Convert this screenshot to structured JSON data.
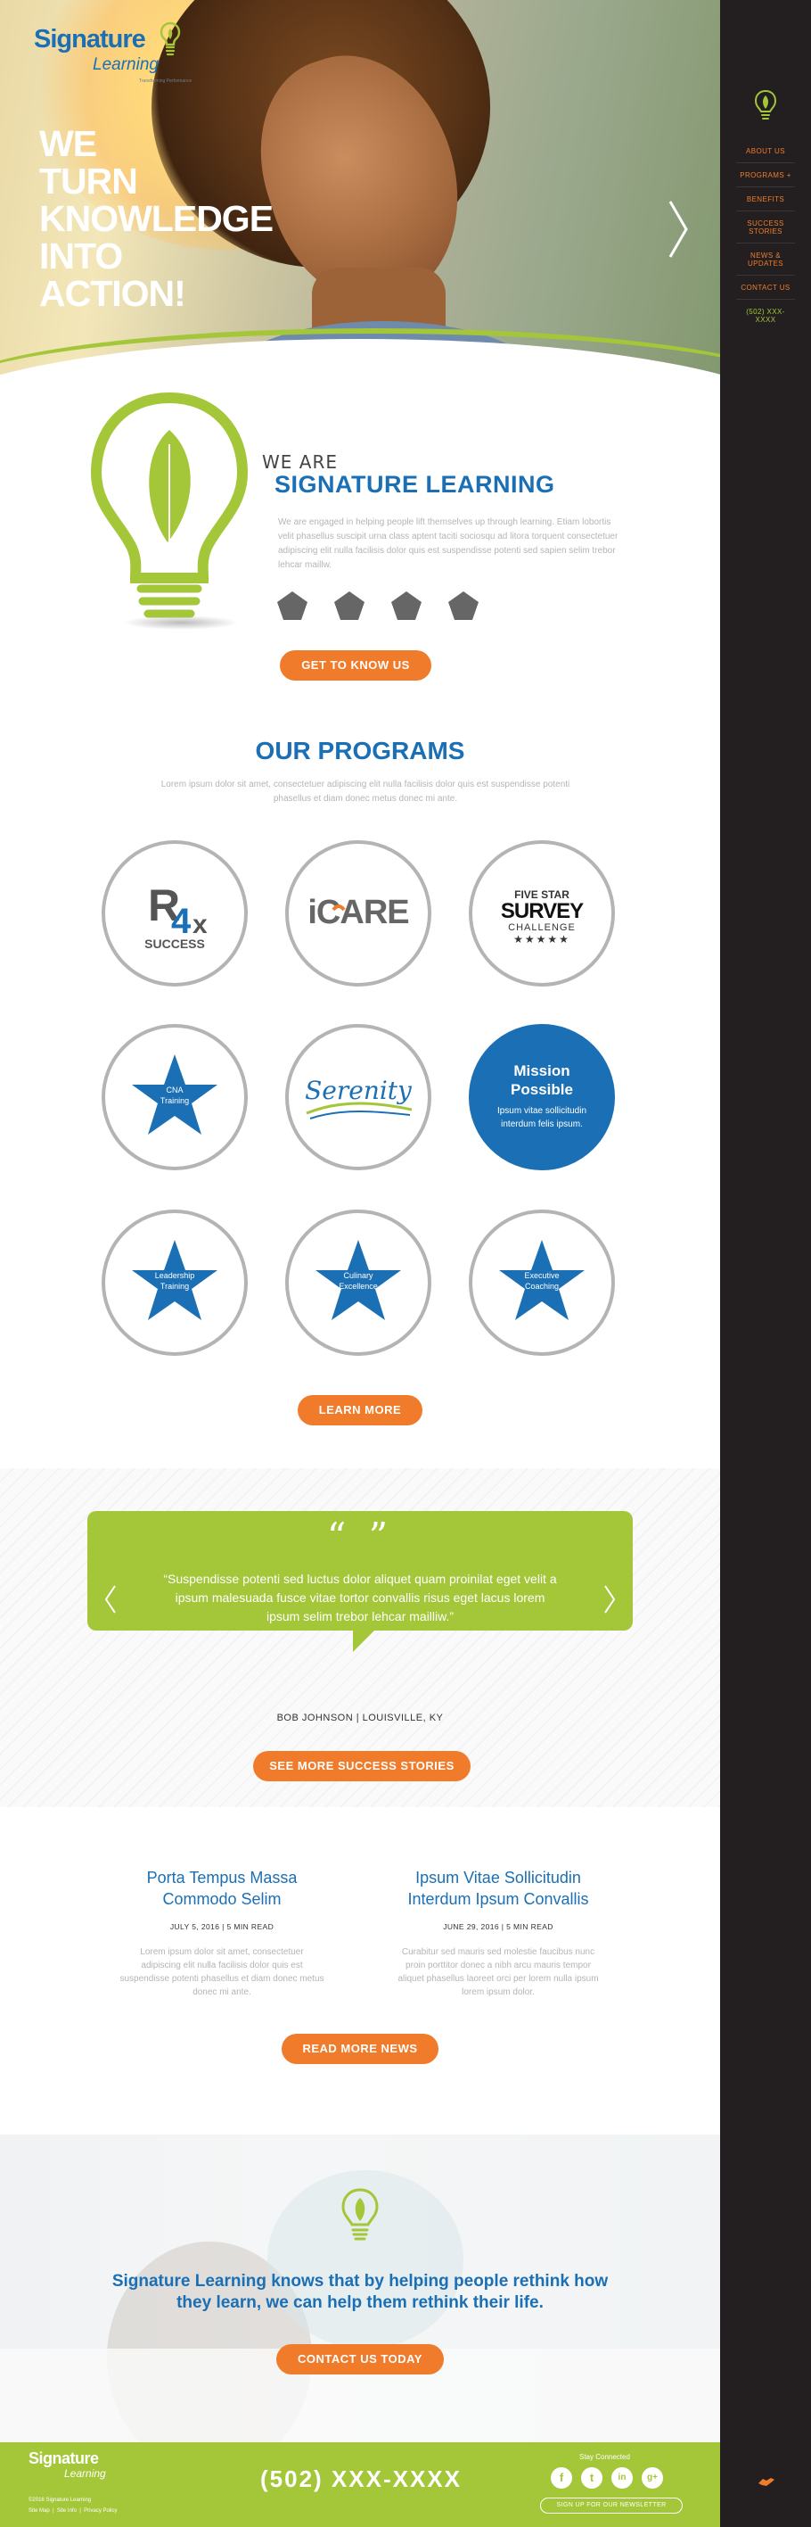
{
  "brand": {
    "logo_main": "Signature",
    "logo_sub": "Learning",
    "tagline": "Transforming Performance"
  },
  "nav": {
    "items": [
      {
        "label": "ABOUT US"
      },
      {
        "label": "PROGRAMS +"
      },
      {
        "label": "BENEFITS"
      },
      {
        "label": "SUCCESS STORIES"
      },
      {
        "label": "NEWS & UPDATES"
      },
      {
        "label": "CONTACT US"
      }
    ],
    "phone": "(502) XXX-XXXX"
  },
  "hero": {
    "line1": "WE",
    "line2": "TURN",
    "line3": "KNOWLEDGE",
    "line4": "INTO",
    "line5": "ACTION!",
    "next_icon": "chevron-right-icon"
  },
  "about": {
    "kicker": "WE ARE",
    "title": "SIGNATURE LEARNING",
    "text": "We are engaged in helping people lift themselves up through learning. Etiam lobortis velit phasellus suscipit urna class aptent taciti sociosqu ad litora torquent consectetuer adipiscing elit nulla facilisis dolor quis est suspendisse potenti sed sapien selim trebor lehcar maillw.",
    "button": "GET TO KNOW US"
  },
  "programs": {
    "title": "OUR PROGRAMS",
    "subtitle": "Lorem ipsum dolor sit amet, consectetuer adipiscing elit nulla facilisis dolor quis est suspendisse potenti phasellus et diam donec metus donec mi ante.",
    "items": [
      {
        "name": "Rx 4 Success",
        "line1": "R",
        "line2": "4x",
        "line3": "SUCCESS"
      },
      {
        "name": "iCARE",
        "label": "iCARE"
      },
      {
        "name": "Five Star Survey Challenge",
        "line1": "FIVE STAR",
        "line2": "SURVEY",
        "line3": "CHALLENGE",
        "stars": "★★★★★"
      },
      {
        "name": "CNA Training",
        "label1": "CNA",
        "label2": "Training"
      },
      {
        "name": "Serenity",
        "label": "Serenity"
      },
      {
        "name": "Mission Possible",
        "title1": "Mission",
        "title2": "Possible",
        "text": "Ipsum vitae sollicitudin interdum felis ipsum."
      },
      {
        "name": "Leadership Training",
        "label1": "Leadership",
        "label2": "Training"
      },
      {
        "name": "Culinary Excellence",
        "label1": "Culinary",
        "label2": "Excellence"
      },
      {
        "name": "Executive Coaching",
        "label1": "Executive",
        "label2": "Coaching"
      }
    ],
    "button": "LEARN MORE"
  },
  "testimonial": {
    "quote_marks": "“ ”",
    "text": "“Suspendisse potenti sed luctus dolor aliquet quam proinilat eget velit a ipsum malesuada fusce vitae tortor convallis risus eget lacus lorem ipsum selim trebor lehcar mailliw.”",
    "author": "BOB JOHNSON | LOUISVILLE, KY",
    "button": "SEE MORE SUCCESS STORIES"
  },
  "news": {
    "items": [
      {
        "title": "Porta Tempus Massa Commodo Selim",
        "meta": "JULY 5, 2016  |  5 MIN READ",
        "body": "Lorem ipsum dolor sit amet, consectetuer adipiscing elit nulla facilisis dolor quis est suspendisse potenti phasellus et diam donec metus donec mi ante."
      },
      {
        "title": "Ipsum Vitae Sollicitudin Interdum Ipsum Convallis",
        "meta": "JUNE 29, 2016  |  5 MIN READ",
        "body": "Curabitur sed mauris sed molestie faucibus nunc proin porttitor donec a nibh arcu mauris tempor aliquet phasellus laoreet orci per lorem nulla ipsum lorem ipsum dolor."
      }
    ],
    "button": "READ MORE NEWS"
  },
  "cta": {
    "text": "Signature Learning knows that by helping people rethink how they learn, we can help them rethink their life.",
    "button": "CONTACT US TODAY"
  },
  "footer": {
    "logo_main": "Signature",
    "logo_sub": "Learning",
    "copyright": "©2016 Signature Learning",
    "links": [
      "Site Map",
      "Site Info",
      "Privacy Policy"
    ],
    "phone": "(502) XXX-XXXX",
    "stay_connected": "Stay Connected",
    "social": [
      {
        "icon": "facebook-icon",
        "glyph": "f"
      },
      {
        "icon": "twitter-icon",
        "glyph": "t"
      },
      {
        "icon": "linkedin-icon",
        "glyph": "in"
      },
      {
        "icon": "google-plus-icon",
        "glyph": "g+"
      }
    ],
    "newsletter": "SIGN UP FOR OUR NEWSLETTER"
  },
  "colors": {
    "brand_blue": "#1a6fb5",
    "accent_orange": "#f07c2b",
    "accent_green": "#a4c639",
    "sidebar_dark": "#231f20",
    "circle_border": "#b4b4b4",
    "pentagon_gray": "#666666"
  }
}
